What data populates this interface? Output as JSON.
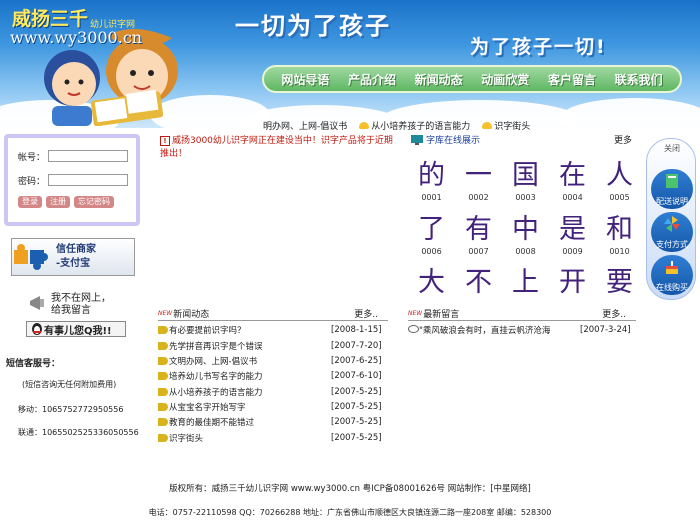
{
  "header": {
    "site_name": "威扬三千",
    "site_sub": "幼儿识字网",
    "site_url": "www.wy3000.cn",
    "slogan1": "一切为了孩子",
    "slogan2": "为了孩子一切!"
  },
  "nav": {
    "items": [
      {
        "label": "网站导语"
      },
      {
        "label": "产品介绍"
      },
      {
        "label": "新闻动态"
      },
      {
        "label": "动画欣赏"
      },
      {
        "label": "客户留言"
      },
      {
        "label": "联系我们"
      }
    ]
  },
  "ticker": {
    "items": [
      "明办网、上网-倡议书",
      "从小培养孩子的语言能力",
      "识字街头"
    ]
  },
  "login": {
    "account_label": "帐号：",
    "password_label": "密码：",
    "account_value": "",
    "password_value": "",
    "login_button": "登录",
    "register_button": "注册",
    "forgot_button": "忘记密码"
  },
  "alipay": {
    "line1": "信任商家",
    "line2": "-支付宝"
  },
  "message": {
    "line1": "我不在网上，",
    "line2": "给我留言",
    "qq_button": "有事儿您Q我!!"
  },
  "sms": {
    "title": "短信客服号：",
    "note": "(短信咨询无任何附加费用)",
    "mobile": "移动：10657527729505​56",
    "unicom": "联通：1065502525336050556"
  },
  "notice": {
    "text": "威扬3000幼儿识字网正在建设当中！识字产品将于近期推出！"
  },
  "char_library": {
    "title": "字库在线展示",
    "more": "更多",
    "rows": [
      {
        "chars": [
          "的",
          "一",
          "国",
          "在",
          "人"
        ],
        "nums": [
          "0001",
          "0002",
          "0003",
          "0004",
          "0005"
        ]
      },
      {
        "chars": [
          "了",
          "有",
          "中",
          "是",
          "和"
        ],
        "nums": [
          "0006",
          "0007",
          "0008",
          "0009",
          "0010"
        ]
      },
      {
        "chars": [
          "大",
          "不",
          "上",
          "开",
          "要"
        ],
        "nums": []
      }
    ]
  },
  "sidebar": {
    "close": "关闭",
    "buttons": [
      {
        "label": "配送说明"
      },
      {
        "label": "支付方式"
      },
      {
        "label": "在线购买"
      }
    ]
  },
  "news": {
    "title": "新闻动态",
    "more": "更多..",
    "items": [
      {
        "title": "有必要提前识字吗？",
        "date": "[2008-1-15]"
      },
      {
        "title": "先学拼音再识字是个错误",
        "date": "[2007-7-20]"
      },
      {
        "title": "文明办网、上网-倡议书",
        "date": "[2007-6-25]"
      },
      {
        "title": "培养幼儿书写名字的能力",
        "date": "[2007-6-10]"
      },
      {
        "title": "从小培养孩子的语言能力",
        "date": "[2007-5-25]"
      },
      {
        "title": "从宝宝名字开始写字",
        "date": "[2007-5-25]"
      },
      {
        "title": "教育的最佳期不能错过",
        "date": "[2007-5-25]"
      },
      {
        "title": "识字街头",
        "date": "[2007-5-25]"
      }
    ]
  },
  "guestbook": {
    "title": "最新留言",
    "more": "更多..",
    "items": [
      {
        "title": "\"乘风破浪会有时，直挂云帆济沧海",
        "date": "[2007-3-24]"
      }
    ]
  },
  "footer": {
    "line1": "版权所有：威扬三千幼儿识字网 www.wy3000.cn 粤ICP备08001626号  网站制作：[中星网络]",
    "line2": "电话：0757-22110598  QQ：70266288  地址：广东省佛山市顺德区大良镇连源二路一座208室  邮编：528300"
  },
  "colors": {
    "char_purple": "#43227c",
    "notice_red": "#c2180d",
    "nav_green": "#5fb763"
  }
}
